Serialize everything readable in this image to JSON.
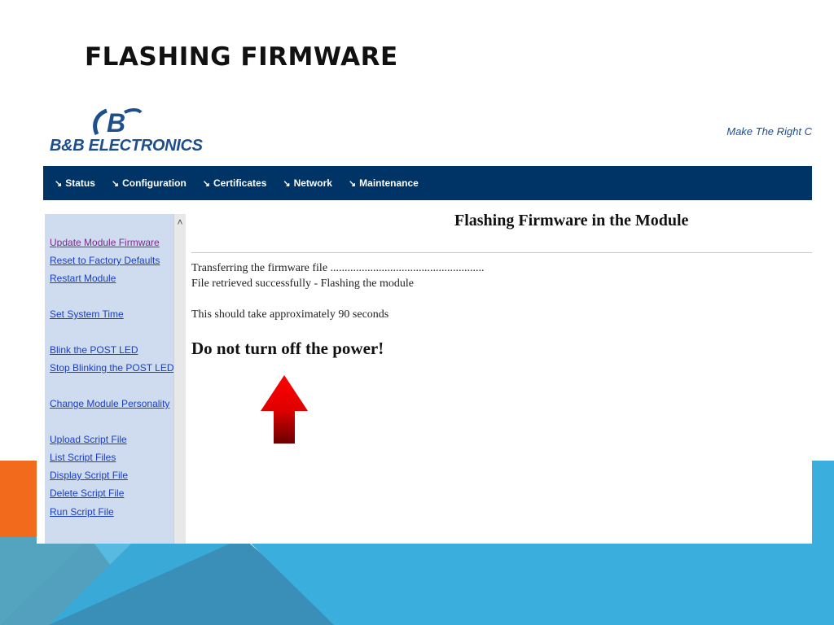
{
  "slide": {
    "title": "FLASHING FIRMWARE"
  },
  "header": {
    "logo_text": "B&B ELECTRONICS",
    "tagline": "Make The Right C"
  },
  "nav": {
    "items": [
      {
        "label": "Status"
      },
      {
        "label": "Configuration"
      },
      {
        "label": "Certificates"
      },
      {
        "label": "Network"
      },
      {
        "label": "Maintenance"
      }
    ]
  },
  "sidebar": {
    "items": [
      {
        "label": "Update Module Firmware"
      },
      {
        "label": "Reset to Factory Defaults"
      },
      {
        "label": "Restart Module"
      },
      {
        "label": "Set System Time"
      },
      {
        "label": "Blink the POST LED"
      },
      {
        "label": "Stop Blinking the POST LED"
      },
      {
        "label": "Change Module Personality"
      },
      {
        "label": "Upload Script File"
      },
      {
        "label": "List Script Files"
      },
      {
        "label": "Display Script File"
      },
      {
        "label": "Delete Script File"
      },
      {
        "label": "Run Script File"
      }
    ]
  },
  "content": {
    "title": "Flashing Firmware in the Module",
    "transfer_line": "Transferring the firmware file ......................................................",
    "status_line": "File retrieved successfully - Flashing the module",
    "time_line": "This should take approximately 90 seconds",
    "warning": "Do not turn off the power!"
  },
  "colors": {
    "nav_bg": "#003366",
    "sidebar_bg": "#cfdcef",
    "link": "#1a3ec2",
    "accent_orange": "#f26a1b",
    "accent_blue": "#3aaedc",
    "arrow_red": "#ff0000"
  },
  "icons": {
    "nav_item": "arrow-down-right-icon",
    "scroll": "chevron-up-icon",
    "pointer": "red-up-arrow-icon"
  }
}
